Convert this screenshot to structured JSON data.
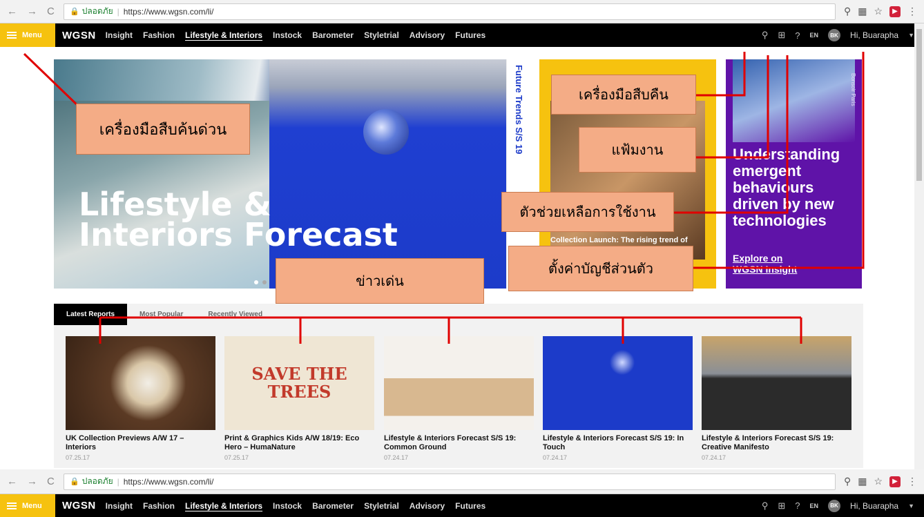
{
  "browser": {
    "safe_label": "ปลอดภัย",
    "url": "https://www.wgsn.com/li/",
    "back": "←",
    "forward": "→",
    "reload": "C"
  },
  "site_nav": {
    "menu_label": "Menu",
    "logo": "WGSN",
    "links": [
      "Insight",
      "Fashion",
      "Lifestyle & Interiors",
      "Instock",
      "Barometer",
      "Styletrial",
      "Advisory",
      "Futures"
    ],
    "active_link": "Lifestyle & Interiors",
    "language": "EN",
    "avatar_initials": "BK",
    "greeting": "Hi, Buarapha"
  },
  "hero": {
    "title_line1": "Lifestyle &",
    "title_line2": "Interiors Forecast",
    "side_label": "Future Trends S/S 19"
  },
  "promo_yellow": {
    "caption": "Collection Launch: The rising trend of"
  },
  "promo_purple": {
    "brand": "Bonsoir Paris",
    "headline": "Understanding emergent behaviours driven by new technologies",
    "cta_line1": "Explore on",
    "cta_line2": "WGSN Insight"
  },
  "callouts": {
    "quick_search": "เครื่องมือสืบค้นด่วน",
    "search_tool": "เครื่องมือสืบคืน",
    "folder": "แฟ้มงาน",
    "help": "ตัวช่วยเหลือการใช้งาน",
    "account": "ตั้งค่าบัญชีส่วนตัว",
    "news": "ข่าวเด่น"
  },
  "tabs": [
    "Latest Reports",
    "Most Popular",
    "Recently Viewed"
  ],
  "reports": [
    {
      "title": "UK Collection Previews A/W 17 – Interiors",
      "date": "07.25.17"
    },
    {
      "title": "Print & Graphics Kids A/W 18/19: Eco Hero – HumaNature",
      "date": "07.25.17"
    },
    {
      "title": "Lifestyle & Interiors Forecast S/S 19: Common Ground",
      "date": "07.24.17"
    },
    {
      "title": "Lifestyle & Interiors Forecast S/S 19: In Touch",
      "date": "07.24.17"
    },
    {
      "title": "Lifestyle & Interiors Forecast S/S 19: Creative Manifesto",
      "date": "07.24.17"
    }
  ],
  "report_image_text": {
    "save_trees": "SAVE THE TREES"
  },
  "colors": {
    "accent_yellow": "#f6c20f",
    "purple": "#5f13a8",
    "callout": "#f4ac86",
    "line_red": "#e00000"
  }
}
